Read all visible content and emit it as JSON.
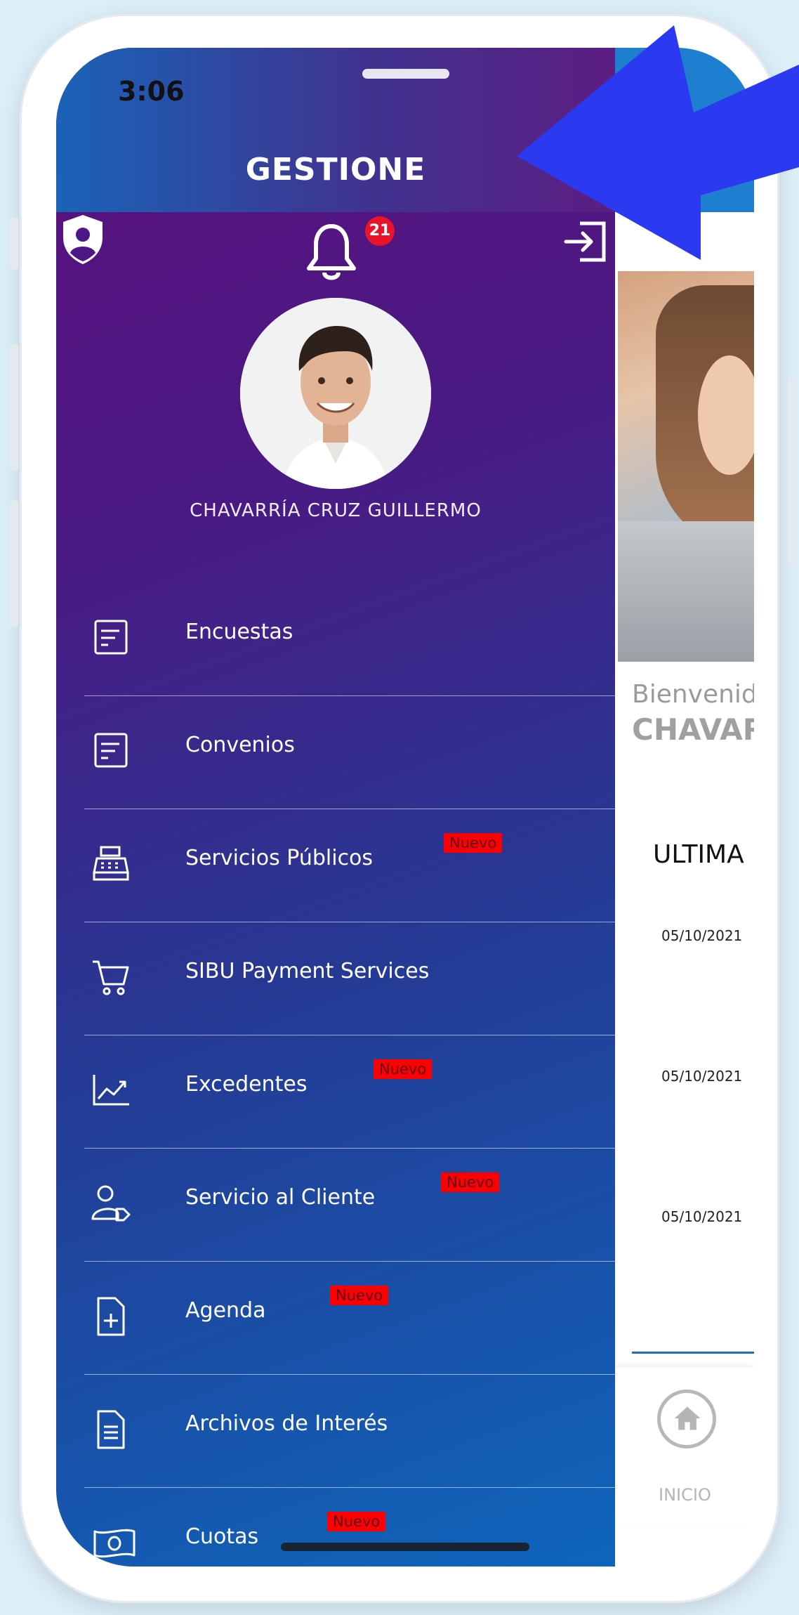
{
  "status_bar": {
    "time": "3:06"
  },
  "header": {
    "title": "GESTIONE"
  },
  "notifications": {
    "count": "21"
  },
  "user": {
    "name": "CHAVARRÍA CRUZ GUILLERMO"
  },
  "menu": {
    "new_badge": "Nuevo",
    "items": [
      {
        "label": "Encuestas",
        "icon": "survey-icon",
        "is_new": false
      },
      {
        "label": "Convenios",
        "icon": "document-icon",
        "is_new": false
      },
      {
        "label": "Servicios Públicos",
        "icon": "cash-register-icon",
        "is_new": true
      },
      {
        "label": "SIBU Payment Services",
        "icon": "cart-icon",
        "is_new": false
      },
      {
        "label": "Excedentes",
        "icon": "trend-chart-icon",
        "is_new": true
      },
      {
        "label": "Servicio al Cliente",
        "icon": "user-tag-icon",
        "is_new": true
      },
      {
        "label": "Agenda",
        "icon": "file-plus-icon",
        "is_new": true
      },
      {
        "label": "Archivos de Interés",
        "icon": "file-text-icon",
        "is_new": false
      },
      {
        "label": "Cuotas",
        "icon": "money-icon",
        "is_new": true
      }
    ]
  },
  "background_app": {
    "welcome": "Bienvenid",
    "name_partial": "CHAVAR",
    "section": "ULTIMA",
    "dates": [
      "05/10/2021",
      "05/10/2021",
      "05/10/2021"
    ],
    "home_label": "INICIO"
  },
  "colors": {
    "drawer_top": "#5c0f7d",
    "drawer_bottom": "#0e66bc",
    "badge": "#e9142a",
    "new_badge": "#ff0000",
    "arrow": "#2b3af0"
  }
}
